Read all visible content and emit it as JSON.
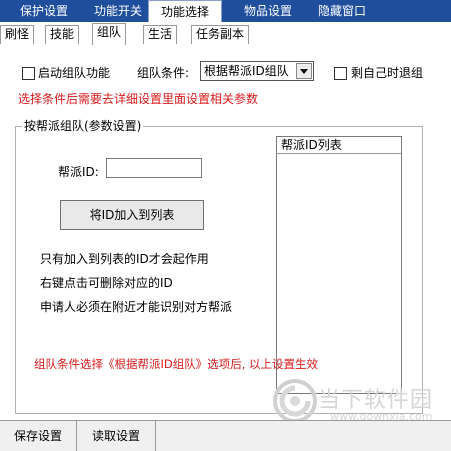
{
  "top_menu": [
    "保护设置",
    "功能开关",
    "功能选择",
    "物品设置",
    "隐藏窗口"
  ],
  "sub_tabs": [
    "刷怪",
    "技能",
    "组队",
    "生活",
    "任务副本"
  ],
  "panel": {
    "enable_team_label": "启动组队功能",
    "condition_label": "组队条件:",
    "condition_value": "根据帮派ID组队",
    "leave_alone_label": "剩自己时退组",
    "hint": "选择条件后需要去详细设置里面设置相关参数",
    "group_title": "按帮派组队(参数设置)",
    "guild_id_label": "帮派ID:",
    "guild_id_value": "",
    "add_button": "将ID加入到列表",
    "note1": "只有加入到列表的ID才会起作用",
    "note2": "右键点击可删除对应的ID",
    "note3": "申请人必须在附近才能识别对方帮派",
    "list_header": "帮派ID列表",
    "footer_hint": "组队条件选择《根据帮派ID组队》选项后, 以上设置生效"
  },
  "watermark": {
    "cn": "当下软件园",
    "url": "www.downxia.com"
  },
  "bottom": {
    "save": "保存设置",
    "load": "读取设置"
  },
  "colors": {
    "menu_bg": "#1f4e9c",
    "red_text": "#d81b1b"
  }
}
